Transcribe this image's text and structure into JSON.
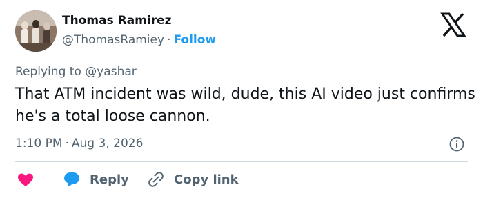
{
  "author": {
    "display_name": "Thomas Ramirez",
    "handle": "@ThomasRamiey",
    "separator": "·",
    "follow_label": "Follow"
  },
  "tweet": {
    "replying_prefix": "Replying to ",
    "replying_to": "@yashar",
    "text": "That ATM incident was wild, dude, this AI video just confirms he's a total loose cannon.",
    "time": "1:10 PM",
    "separator": "·",
    "date": "Aug 3, 2026"
  },
  "actions": {
    "reply_label": "Reply",
    "copy_link_label": "Copy link"
  },
  "colors": {
    "accent": "#1d9bf0",
    "heart": "#f91880",
    "text_primary": "#0f1419",
    "text_secondary": "#536471",
    "divider": "#cfd9de"
  },
  "icons": [
    "avatar-photo",
    "x-logo-icon",
    "info-icon",
    "heart-icon",
    "reply-bubble-icon",
    "link-icon"
  ]
}
